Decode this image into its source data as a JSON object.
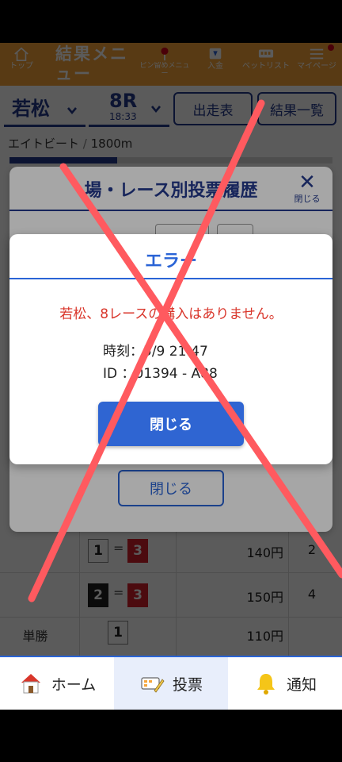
{
  "topnav": {
    "top_label": "トップ",
    "title": "結果メニュー",
    "items": [
      {
        "label": "ピン留めメニュー",
        "icon": "pin-icon"
      },
      {
        "label": "入金",
        "icon": "deposit-icon"
      },
      {
        "label": "ベットリスト",
        "icon": "betlist-icon"
      },
      {
        "label": "マイページ",
        "icon": "mypage-icon"
      }
    ]
  },
  "race_header": {
    "venue": "若松",
    "race_num": "8R",
    "race_time": "18:33",
    "entries_button": "出走表",
    "results_button": "結果一覧"
  },
  "race_info": {
    "name": "エイトビート",
    "separator": " / ",
    "distance": "1800m"
  },
  "history_modal": {
    "title": "場・レース別投票履歴",
    "close_label": "閉じる",
    "close_button": "閉じる"
  },
  "error_dialog": {
    "title": "エラー",
    "message": "若松、8レースの購入はありません。",
    "time_label": "時刻：",
    "time_value": "5/9 21:47",
    "id_label": "ID ：",
    "id_value": "01394 - A88",
    "close_button": "閉じる"
  },
  "results_table": {
    "rows": [
      {
        "kind": "",
        "first": "1",
        "second": "3",
        "payout": "140円",
        "popularity": "2"
      },
      {
        "kind": "",
        "first": "2",
        "second": "3",
        "payout": "150円",
        "popularity": "4"
      },
      {
        "kind": "単勝",
        "first": "1",
        "second": "",
        "payout": "110円",
        "popularity": ""
      }
    ],
    "eq_sign": "="
  },
  "bottomnav": {
    "home": "ホーム",
    "vote": "投票",
    "notify": "通知"
  },
  "colors": {
    "nav_orange": "#f6a53a",
    "primary_navy": "#243a8c",
    "primary_blue": "#2f65d2",
    "error_red": "#d9362b",
    "overlay_x": "#ff5a5f"
  }
}
